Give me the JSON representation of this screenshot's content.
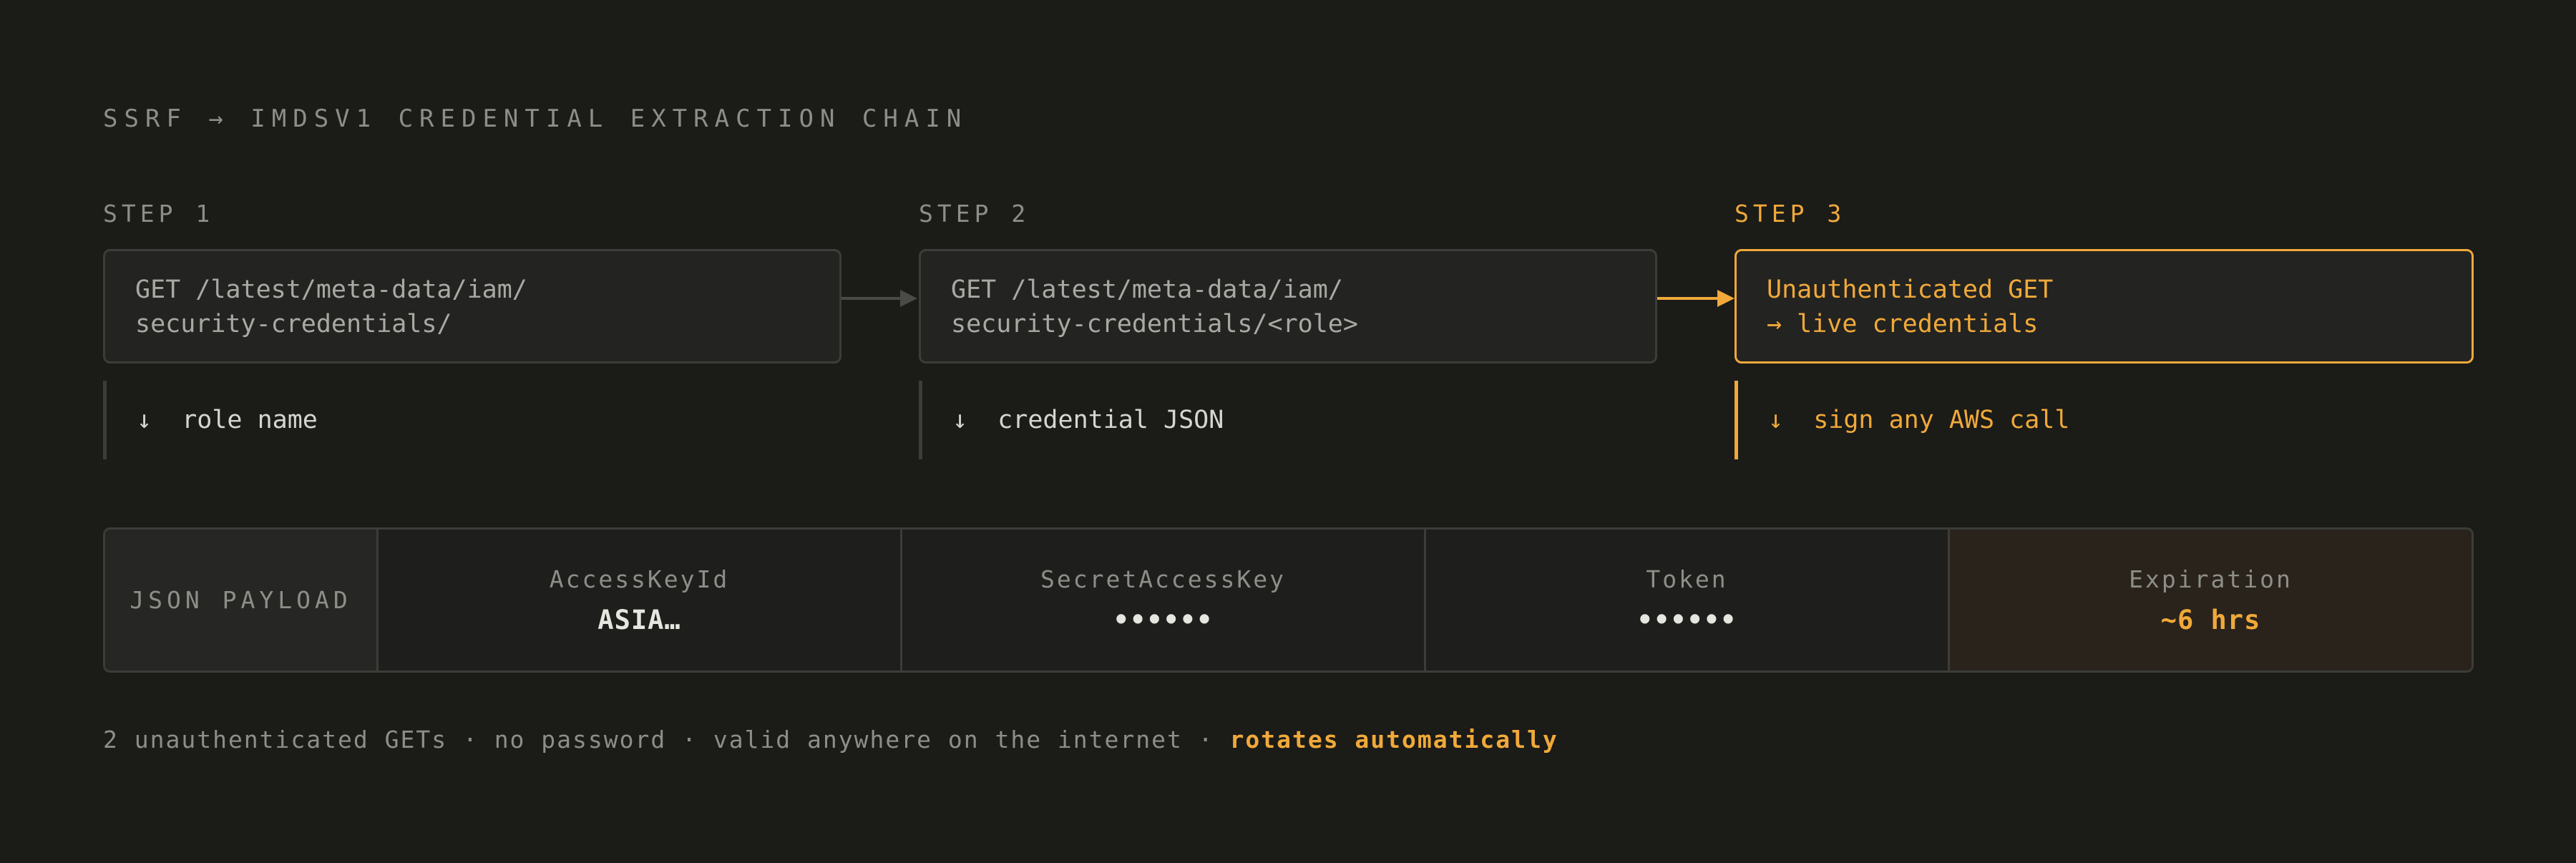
{
  "title": "SSRF → IMDSV1 CREDENTIAL EXTRACTION CHAIN",
  "steps": [
    {
      "label": "STEP 1",
      "request": "GET /latest/meta-data/iam/\nsecurity-credentials/",
      "result": "↓  role name"
    },
    {
      "label": "STEP 2",
      "request": "GET /latest/meta-data/iam/\nsecurity-credentials/<role>",
      "result": "↓  credential JSON"
    },
    {
      "label": "STEP 3",
      "request": "Unauthenticated GET\n→ live credentials",
      "result": "↓  sign any AWS call"
    }
  ],
  "payload": {
    "label": "JSON PAYLOAD",
    "fields": [
      {
        "name": "AccessKeyId",
        "value": "ASIA…"
      },
      {
        "name": "SecretAccessKey",
        "value": "••••••"
      },
      {
        "name": "Token",
        "value": "••••••"
      },
      {
        "name": "Expiration",
        "value": "~6 hrs"
      }
    ]
  },
  "footer": {
    "text": "2 unauthenticated GETs · no password · valid anywhere on the internet · ",
    "emphasis": "rotates automatically"
  },
  "colors": {
    "background": "#1b1b18",
    "accent": "#f0a93a",
    "border": "#3c3c38"
  }
}
